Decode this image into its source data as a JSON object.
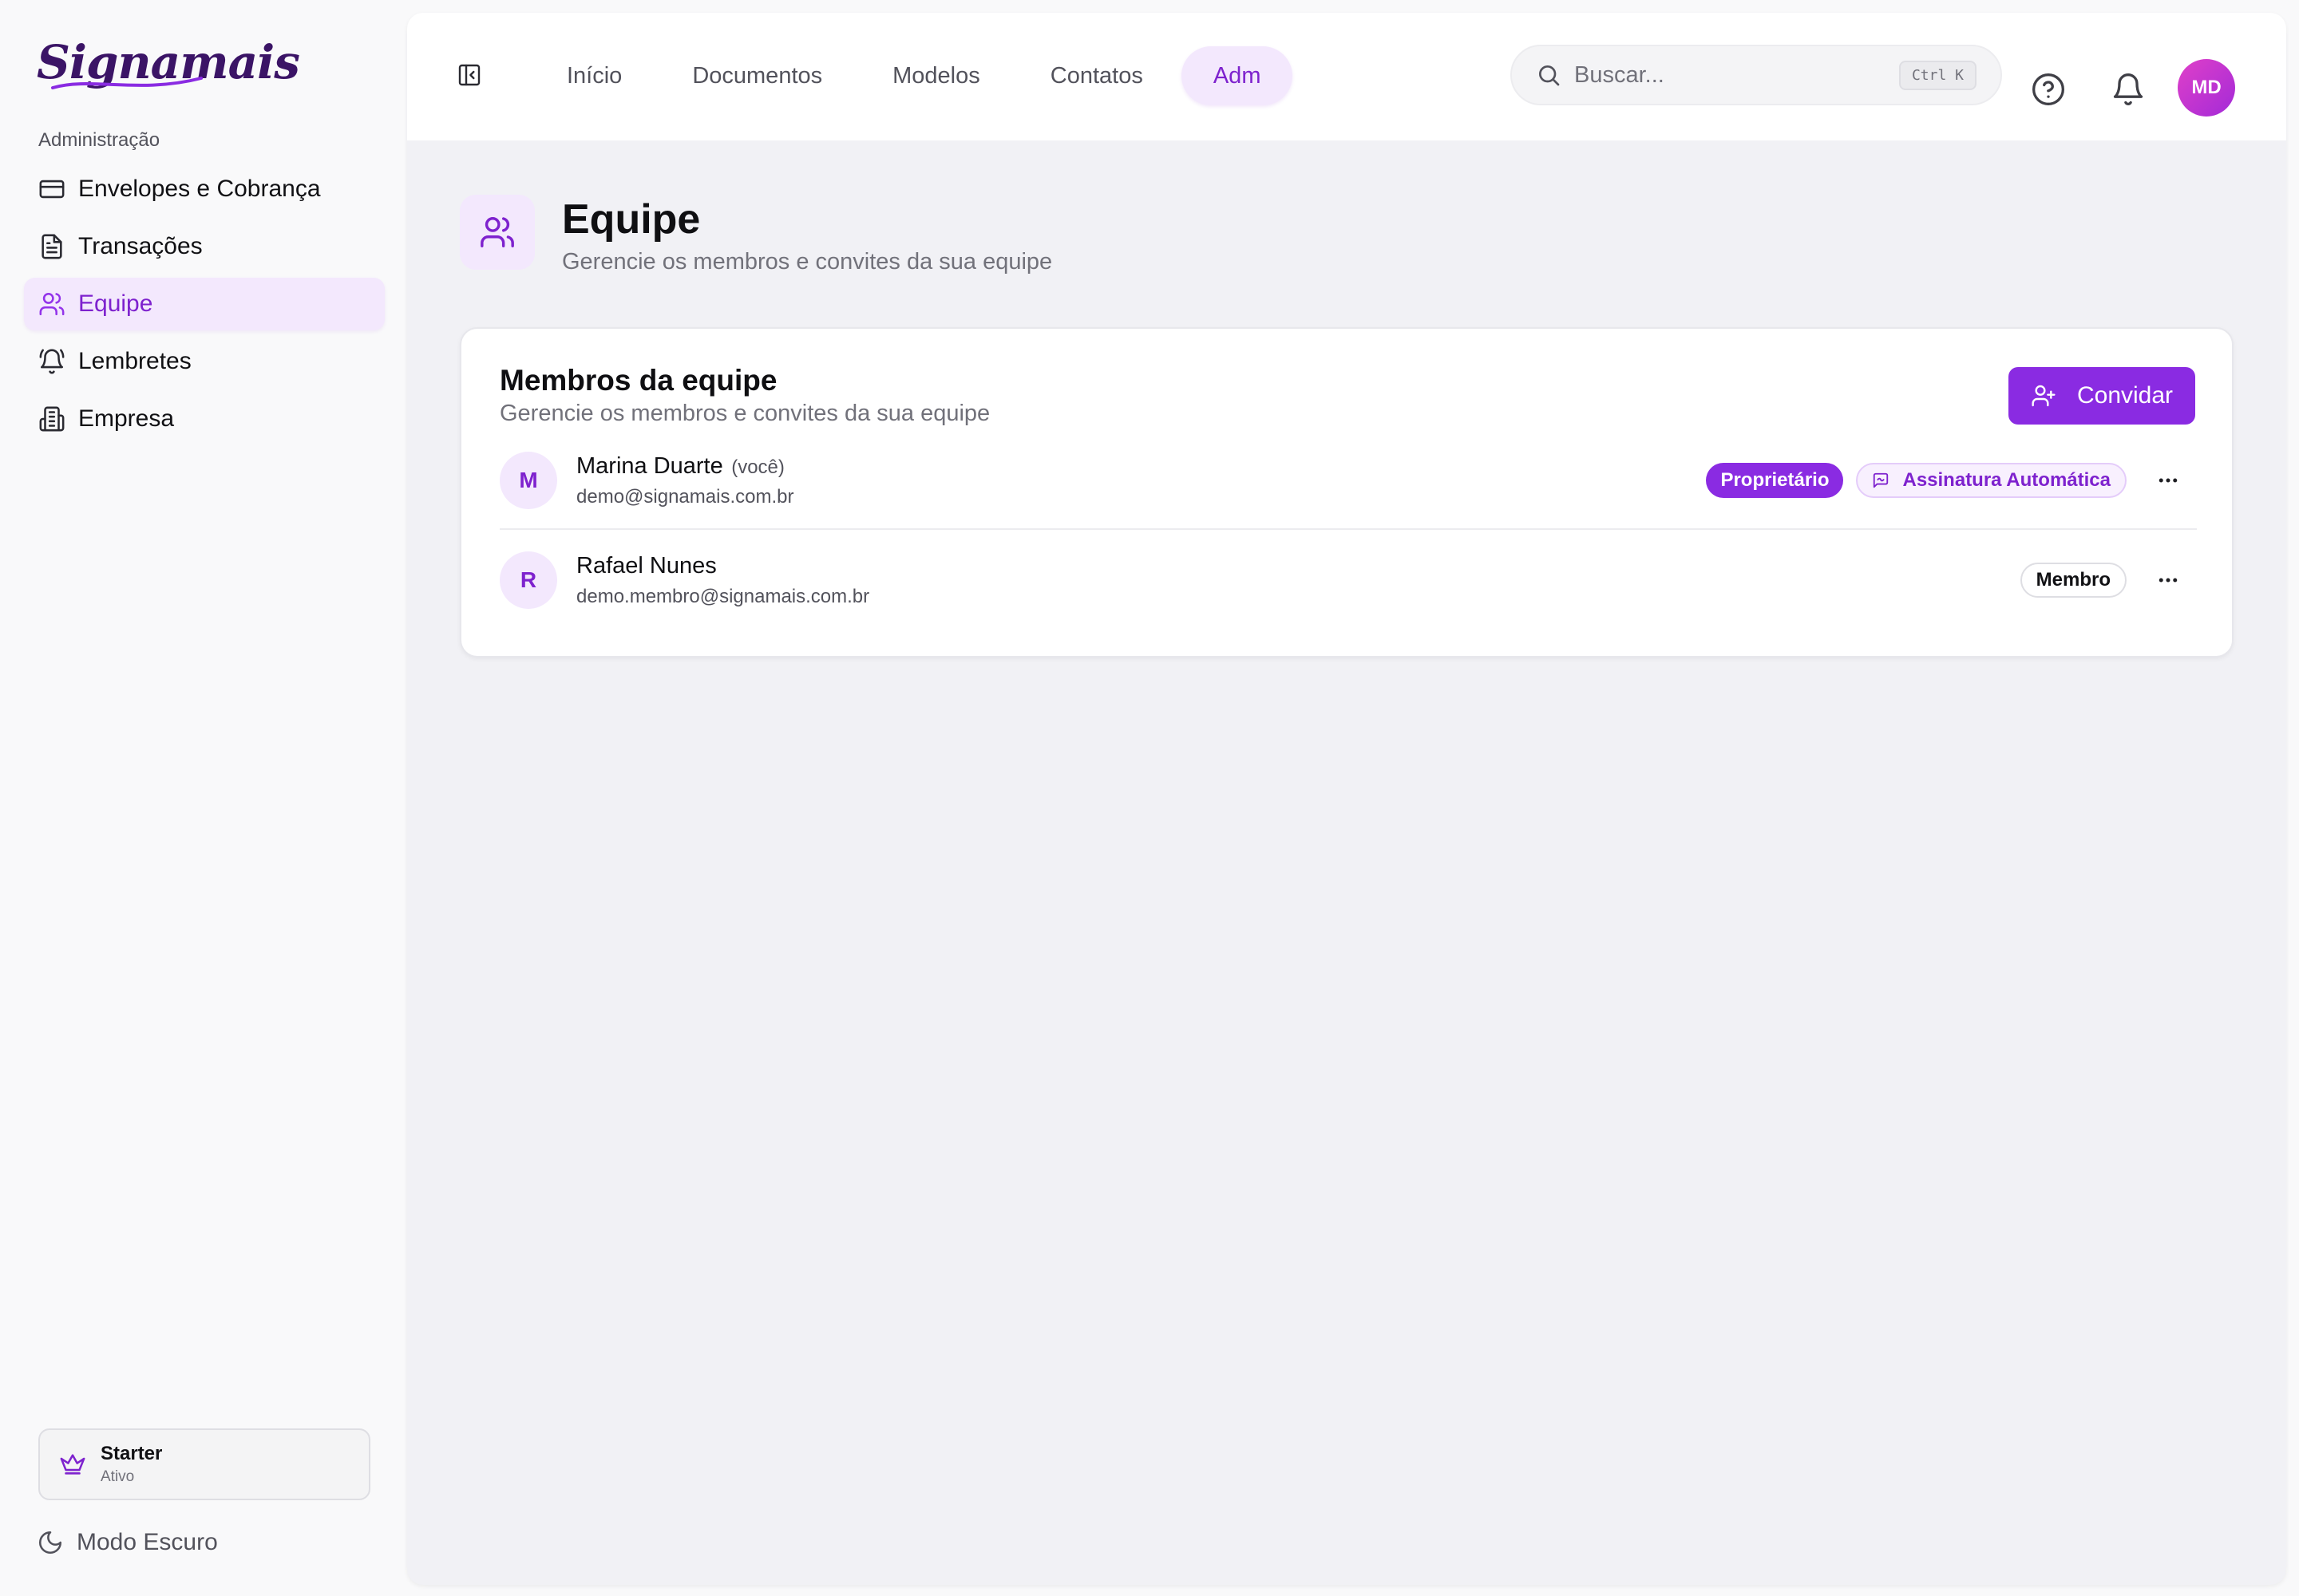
{
  "brand": {
    "logo_text": "Signamais",
    "accent": "#8a2be2"
  },
  "sidebar": {
    "section_label": "Administração",
    "items": [
      {
        "label": "Envelopes e Cobrança",
        "icon": "credit-card-icon"
      },
      {
        "label": "Transações",
        "icon": "file-text-icon"
      },
      {
        "label": "Equipe",
        "icon": "users-icon",
        "active": true
      },
      {
        "label": "Lembretes",
        "icon": "bell-ring-icon"
      },
      {
        "label": "Empresa",
        "icon": "building-icon"
      }
    ],
    "plan": {
      "name": "Starter",
      "status": "Ativo",
      "icon": "crown-icon"
    },
    "dark_mode_label": "Modo Escuro"
  },
  "header": {
    "tabs": [
      {
        "label": "Início"
      },
      {
        "label": "Documentos"
      },
      {
        "label": "Modelos"
      },
      {
        "label": "Contatos"
      },
      {
        "label": "Adm",
        "active": true
      }
    ],
    "search": {
      "placeholder": "Buscar...",
      "value": "",
      "shortcut": "Ctrl K"
    },
    "user_initials": "MD"
  },
  "page": {
    "title": "Equipe",
    "subtitle": "Gerencie os membros e convites da sua equipe"
  },
  "team_card": {
    "title": "Membros da equipe",
    "subtitle": "Gerencie os membros e convites da sua equipe",
    "invite_label": "Convidar",
    "members": [
      {
        "initial": "M",
        "name": "Marina Duarte",
        "you_label": "(você)",
        "email": "demo@signamais.com.br",
        "role": "Proprietário",
        "extra_badge": "Assinatura Automática"
      },
      {
        "initial": "R",
        "name": "Rafael Nunes",
        "email": "demo.membro@signamais.com.br",
        "role": "Membro"
      }
    ]
  }
}
